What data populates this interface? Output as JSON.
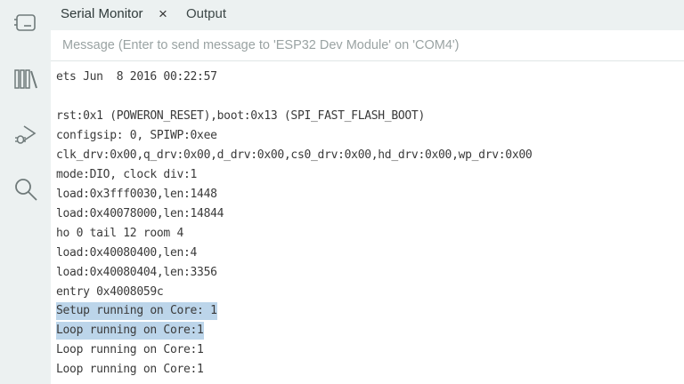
{
  "sidebar": {
    "items": [
      {
        "icon": "board-icon"
      },
      {
        "icon": "library-icon"
      },
      {
        "icon": "debug-icon"
      },
      {
        "icon": "search-icon"
      }
    ]
  },
  "tabs": {
    "active": "Serial Monitor",
    "close_symbol": "×",
    "other": "Output"
  },
  "message": {
    "placeholder": "Message (Enter to send message to 'ESP32 Dev Module' on 'COM4')"
  },
  "log": {
    "lines": [
      "ets Jun  8 2016 00:22:57",
      "",
      "rst:0x1 (POWERON_RESET),boot:0x13 (SPI_FAST_FLASH_BOOT)",
      "configsip: 0, SPIWP:0xee",
      "clk_drv:0x00,q_drv:0x00,d_drv:0x00,cs0_drv:0x00,hd_drv:0x00,wp_drv:0x00",
      "mode:DIO, clock div:1",
      "load:0x3fff0030,len:1448",
      "load:0x40078000,len:14844",
      "ho 0 tail 12 room 4",
      "load:0x40080400,len:4",
      "load:0x40080404,len:3356",
      "entry 0x4008059c",
      "Setup running on Core: 1",
      "Loop running on Core:1",
      "Loop running on Core:1",
      "Loop running on Core:1"
    ]
  }
}
